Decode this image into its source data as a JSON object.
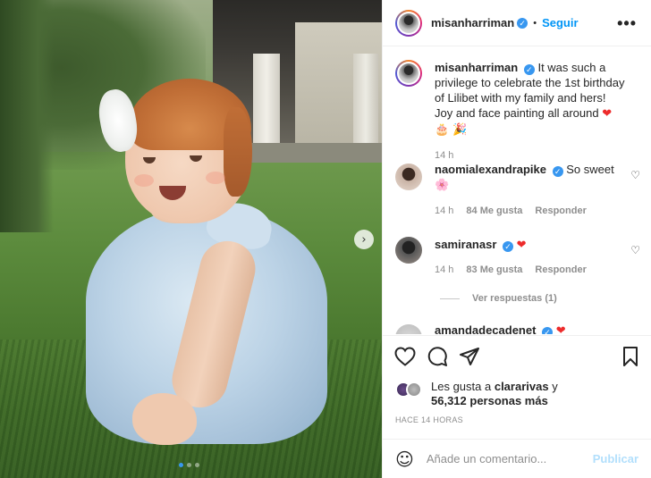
{
  "post": {
    "author": "misanharriman",
    "follow_label": "Seguir",
    "separator": "•",
    "more_label": "•••",
    "next_arrow": "›",
    "slide_count": 3,
    "current_slide": 1
  },
  "caption": {
    "username": "misanharriman",
    "text": "It was such a privilege to celebrate the 1st birthday of Lilibet with my family and hers! Joy and face painting all around",
    "emojis": "❤ 🎂 🎉",
    "time": "14 h"
  },
  "comments": [
    {
      "username": "naomialexandrapike",
      "text": "So sweet",
      "emoji": "🌸",
      "time": "14 h",
      "likes": "84 Me gusta",
      "reply": "Responder"
    },
    {
      "username": "samiranasr",
      "text": "",
      "emoji": "❤",
      "time": "14 h",
      "likes": "83 Me gusta",
      "reply": "Responder",
      "view_replies": "Ver respuestas (1)"
    },
    {
      "username": "amandadecadenet",
      "emoji": "❤"
    }
  ],
  "likes": {
    "prefix": "Les gusta a",
    "user": "clararivas",
    "connector": "y",
    "others": "56,312 personas más"
  },
  "posted_ago": "HACE 14 HORAS",
  "add_comment": {
    "placeholder": "Añade un comentario...",
    "emoji_icon": "☺",
    "post_label": "Publicar"
  },
  "colors": {
    "accent_blue": "#0095f6",
    "verified_blue": "#3897f0",
    "post_disabled": "#b2dffc",
    "heart_red": "#ed2b2b"
  }
}
